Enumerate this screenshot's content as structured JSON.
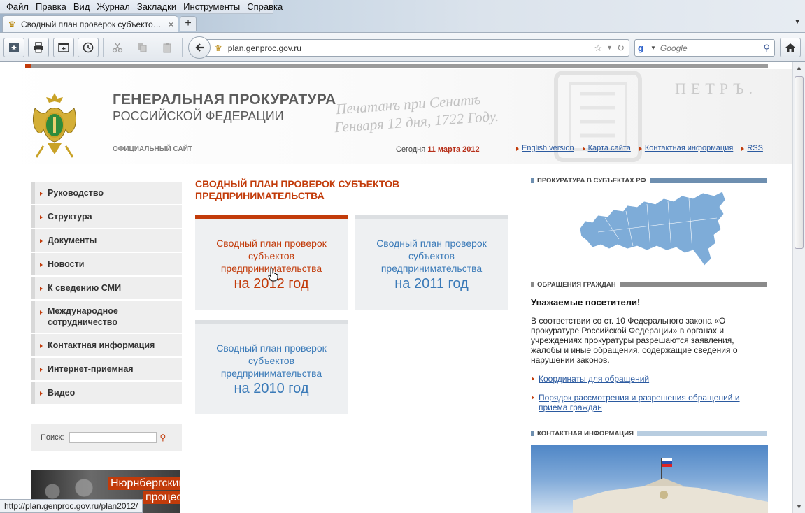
{
  "browser": {
    "menu": [
      "Файл",
      "Правка",
      "Вид",
      "Журнал",
      "Закладки",
      "Инструменты",
      "Справка"
    ],
    "tab_title": "Сводный план проверок субъектов пр...",
    "tab_close": "×",
    "new_tab": "+",
    "url": "plan.genproc.gov.ru",
    "search_placeholder": "Google",
    "status_url": "http://plan.genproc.gov.ru/plan2012/"
  },
  "header": {
    "title": "ГЕНЕРАЛЬНАЯ ПРОКУРАТУРА",
    "subtitle": "РОССИЙСКОЙ ФЕДЕРАЦИИ",
    "official": "ОФИЦИАЛЬНЫЙ САЙТ",
    "script_line1": "Печатанъ при Сенатѣ",
    "script_line2": "Генваря 12 дня, 1722 Году.",
    "script_name": "ПЕТРЪ.",
    "date_prefix": "Сегодня ",
    "date_day": "11",
    "date_rest": " марта 2012",
    "links": [
      "English version",
      "Карта сайта",
      "Контактная информация",
      "RSS"
    ]
  },
  "sidebar": {
    "items": [
      "Руководство",
      "Структура",
      "Документы",
      "Новости",
      "К сведению СМИ",
      "Международное сотрудничество",
      "Контактная информация",
      "Интернет-приемная",
      "Видео"
    ],
    "search_label": "Поиск:",
    "banner_line1": "Нюрнбергский",
    "banner_line2": "процесс"
  },
  "main": {
    "title": "СВОДНЫЙ ПЛАН ПРОВЕРОК СУБЪЕКТОВ ПРЕДПРИНИМАТЕЛЬСТВА",
    "cards": [
      {
        "text": "Сводный план проверок субъектов предпринимательства",
        "year": "на 2012 год",
        "active": true
      },
      {
        "text": "Сводный план проверок субъектов предпринимательства",
        "year": "на 2011 год",
        "active": false
      },
      {
        "text": "Сводный план проверок субъектов предпринимательства",
        "year": "на 2010 год",
        "active": false
      }
    ]
  },
  "right": {
    "regions_heading": "ПРОКУРАТУРА В СУБЪЕКТАХ РФ",
    "appeals_heading": "ОБРАЩЕНИЯ ГРАЖДАН",
    "greeting": "Уважаемые посетители!",
    "appeals_text": "В соответствии со ст. 10 Федерального закона «О прокуратуре Российской Федерации» в органах и учреждениях прокуратуры разрешаются заявления, жалобы и иные обращения, содержащие сведения о нарушении законов.",
    "link1": "Координаты для обращений",
    "link2": "Порядок рассмотрения и разрешения обращений и приема граждан",
    "contact_heading": "КОНТАКТНАЯ ИНФОРМАЦИЯ"
  },
  "colors": {
    "accent_red": "#c23b0a",
    "link_blue": "#2b5aa0",
    "card_blue": "#3a7ab8",
    "map_blue": "#6fa0cf"
  }
}
